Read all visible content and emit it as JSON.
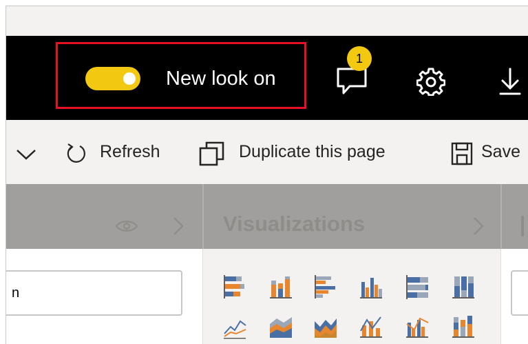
{
  "header": {
    "toggle_label": "New look on",
    "toggle_state": "on",
    "notification_count": "1",
    "accent_color": "#f2c811",
    "highlight_color": "#e81123",
    "icons": [
      "feedback-icon",
      "gear-icon",
      "download-icon"
    ]
  },
  "toolbar": {
    "refresh_label": "Refresh",
    "duplicate_label": "Duplicate this page",
    "save_label": "Save"
  },
  "panes": {
    "visualizations_title": "Visualizations"
  },
  "search": {
    "value": "n"
  }
}
